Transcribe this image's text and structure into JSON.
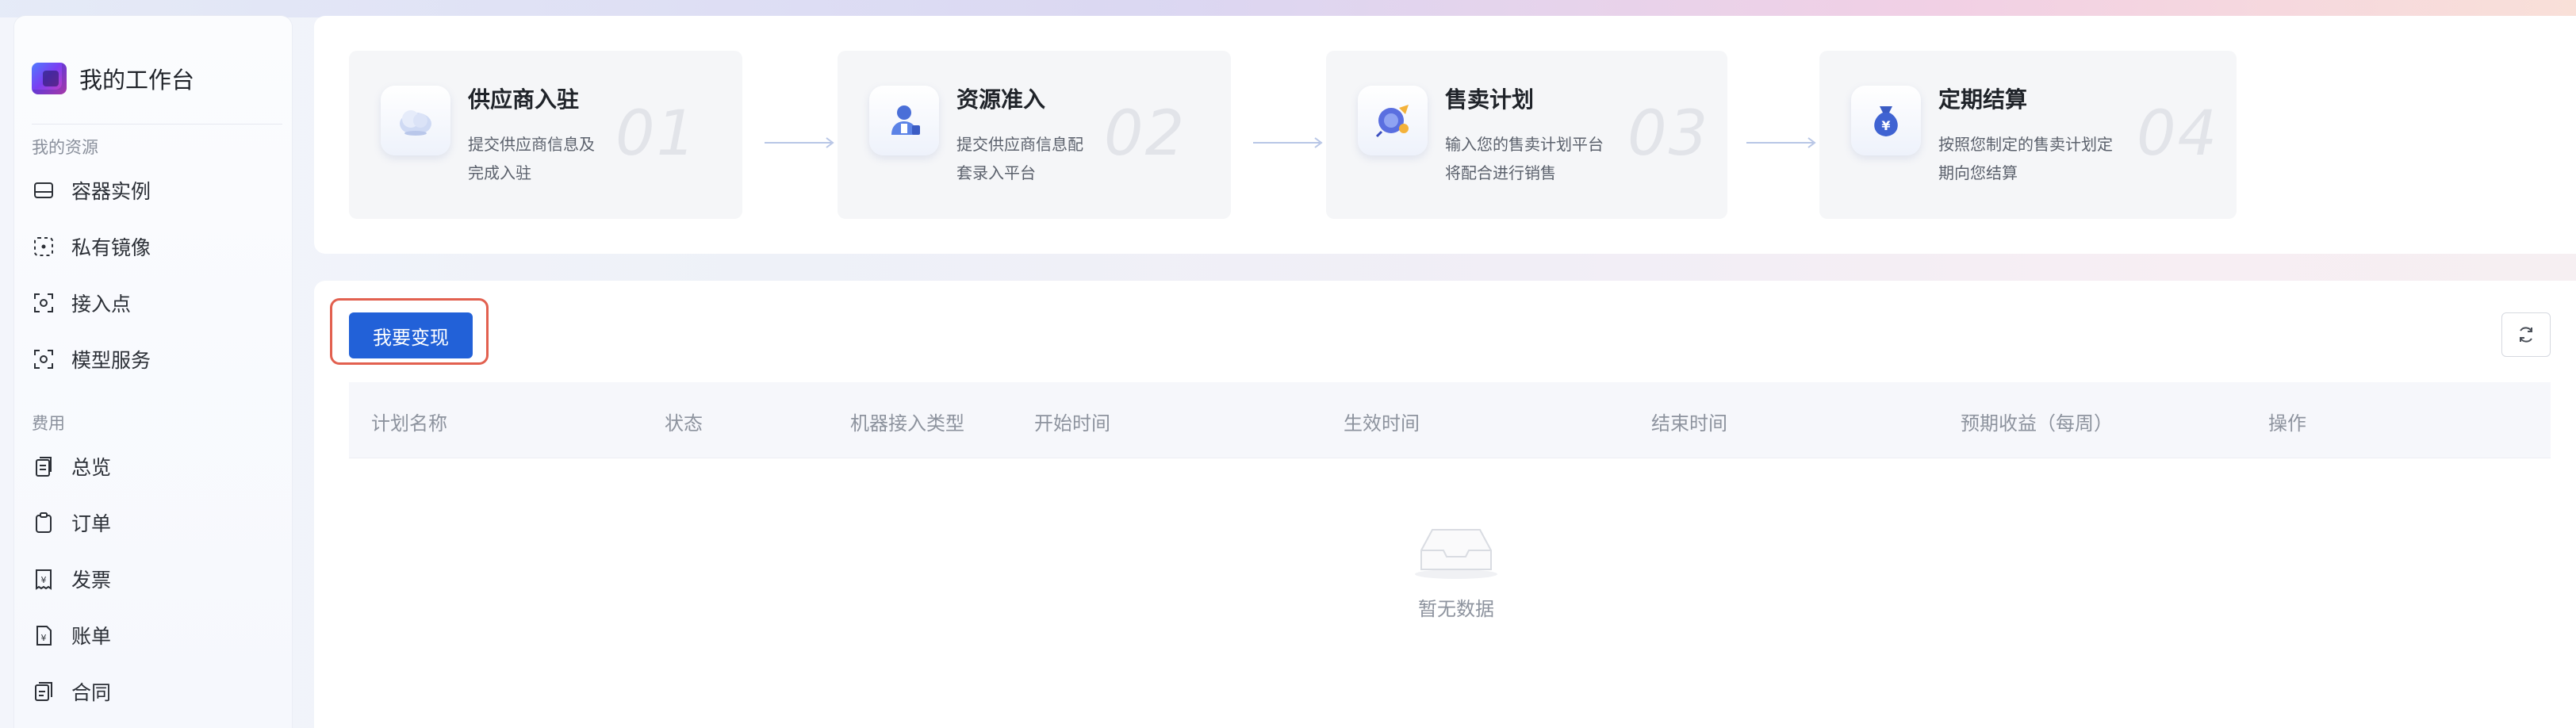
{
  "brand": {
    "title": "我的工作台"
  },
  "sidebar": {
    "sections": [
      {
        "label": "我的资源"
      },
      {
        "label": "费用"
      }
    ],
    "items": [
      {
        "label": "容器实例",
        "icon": "storage-icon"
      },
      {
        "label": "私有镜像",
        "icon": "image-icon"
      },
      {
        "label": "接入点",
        "icon": "endpoint-icon"
      },
      {
        "label": "模型服务",
        "icon": "model-service-icon"
      },
      {
        "label": "总览",
        "icon": "overview-icon"
      },
      {
        "label": "订单",
        "icon": "order-icon"
      },
      {
        "label": "发票",
        "icon": "invoice-icon"
      },
      {
        "label": "账单",
        "icon": "bill-icon"
      },
      {
        "label": "合同",
        "icon": "contract-icon"
      }
    ]
  },
  "steps": [
    {
      "title": "供应商入驻",
      "desc": "提交供应商信息及完成入驻",
      "num": "01",
      "icon": "cloud-icon"
    },
    {
      "title": "资源准入",
      "desc": "提交供应商信息配套录入平台",
      "num": "02",
      "icon": "person-icon"
    },
    {
      "title": "售卖计划",
      "desc": "输入您的售卖计划平台将配合进行销售",
      "num": "03",
      "icon": "plan-icon"
    },
    {
      "title": "定期结算",
      "desc": "按照您制定的售卖计划定期向您结算",
      "num": "04",
      "icon": "money-bag-icon"
    }
  ],
  "main": {
    "primary_button": "我要变现",
    "columns": [
      "计划名称",
      "状态",
      "机器接入类型",
      "开始时间",
      "生效时间",
      "结束时间",
      "预期收益（每周）",
      "操作"
    ],
    "empty_text": "暂无数据"
  },
  "colors": {
    "primary": "#2261d8",
    "highlight": "#e2604f"
  }
}
